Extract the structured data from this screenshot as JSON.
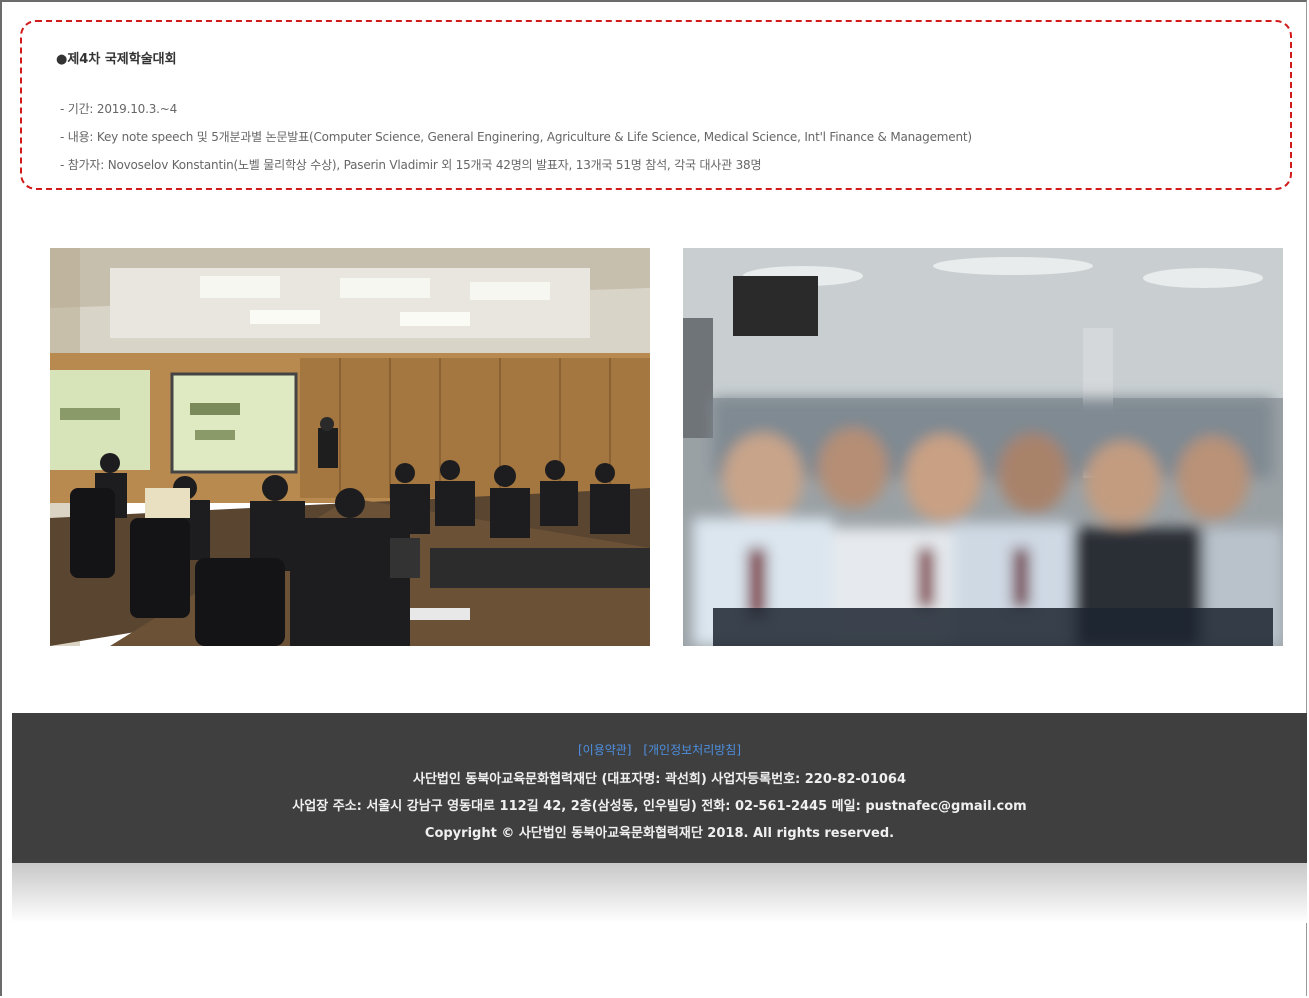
{
  "event": {
    "title": "●제4차 국제학술대회",
    "period": "- 기간: 2019.10.3.~4",
    "content": "- 내용: Key note speech 및 5개분과별 논문발표(Computer Science, General Enginering, Agriculture & Life Science, Medical Science, Int'l Finance & Management)",
    "participants": "- 참가자: Novoselov Konstantin(노벨 물리학상 수상), Paserin Vladimir 외 15개국 42명의 발표자, 13개국 51명 참석, 각국 대사관 38명"
  },
  "footer": {
    "terms_link": "[이용약관]",
    "privacy_link": "[개인정보처리방침]",
    "line1": "사단법인 동북아교육문화협력재단 (대표자명: 곽선희) 사업자등록번호: 220-82-01064",
    "line2": "사업장 주소: 서울시 강남구 영동대로 112길 42, 2층(삼성동, 인우빌딩) 전화: 02-561-2445 메일: pustnafec@gmail.com",
    "line3": "Copyright © 사단법인 동북아교육문화협력재단 2018. All rights reserved."
  },
  "colors": {
    "highlight_border": "#d11a1a",
    "footer_bg": "#3f3f3f",
    "footer_link": "#4d8fe0"
  }
}
